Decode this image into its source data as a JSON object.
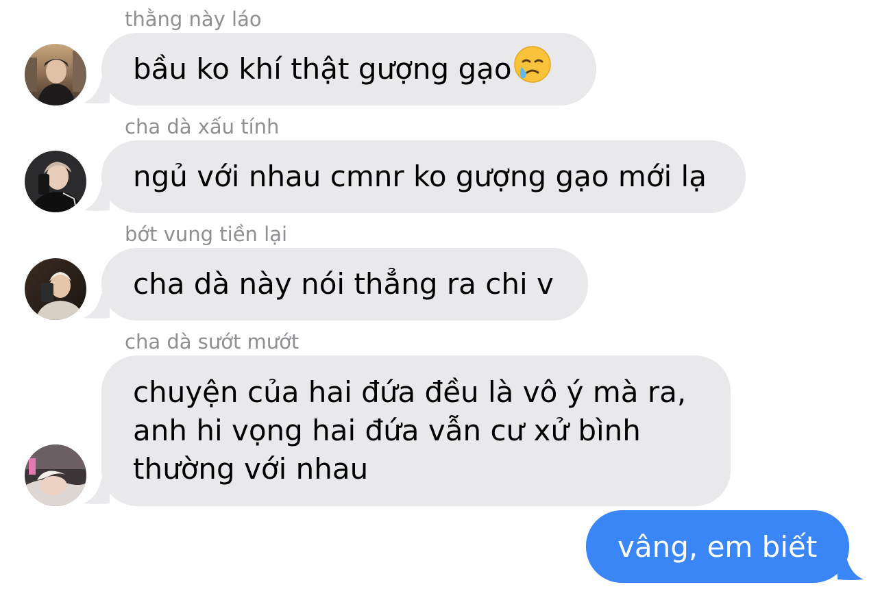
{
  "messages": [
    {
      "sender": "thằng này láo",
      "text": "bầu ko khí thật gượng gạo",
      "emoji": "face-holding-back-tears-icon"
    },
    {
      "sender": "cha dà xấu tính",
      "text": "ngủ với nhau cmnr ko gượng gạo mới lạ"
    },
    {
      "sender": "bớt vung tiền lại",
      "text": "cha dà này nói thẳng ra chi v"
    },
    {
      "sender": "cha dà sướt mướt",
      "lines": [
        "chuyện của hai đứa đều là vô ý mà ra,",
        "anh hi vọng hai đứa vẫn cư xử bình",
        "thường với nhau"
      ]
    }
  ],
  "outgoing": {
    "text": "vâng, em biết"
  },
  "colors": {
    "incoming_bubble": "#e9e9eb",
    "outgoing_bubble": "#3a86f7",
    "sender_name": "#8e8e93"
  }
}
